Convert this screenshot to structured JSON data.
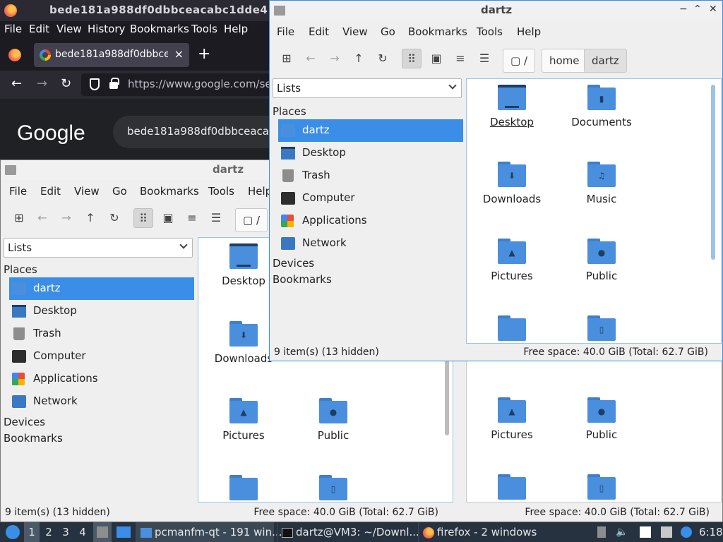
{
  "firefox": {
    "window_title": "bede181a988df0dbbceacabc1dde414",
    "menu": [
      "File",
      "Edit",
      "View",
      "History",
      "Bookmarks",
      "Tools",
      "Help"
    ],
    "tab_title": "bede181a988df0dbbceac",
    "tab_close": "×",
    "new_tab": "+",
    "url": "https://www.google.com/sea",
    "google_logo": "Google",
    "search_text": "bede181a988df0dbbceacab"
  },
  "fm_menu": [
    "File",
    "Edit",
    "View",
    "Go",
    "Bookmarks",
    "Tools",
    "Help"
  ],
  "fm_back": {
    "title": "dartz",
    "menu_visible": [
      "File",
      "Edit",
      "View",
      "Go",
      "Bookmarks",
      "Tools",
      "Help"
    ],
    "path_root": "/",
    "side_combo": "Lists",
    "places_label": "Places",
    "places": [
      "dartz",
      "Desktop",
      "Trash",
      "Computer",
      "Applications",
      "Network"
    ],
    "devices_label": "Devices",
    "bookmarks_label": "Bookmarks",
    "files": [
      "Desktop",
      "Downloads",
      "Pictures",
      "Public"
    ],
    "right_files": [
      "Pictures",
      "Public"
    ],
    "status_left": "9 item(s) (13 hidden)",
    "status_right": "Free space: 40.0 GiB (Total: 62.7 GiB)"
  },
  "fm_front": {
    "title": "dartz",
    "win_controls": [
      "−",
      "⌃",
      "✕"
    ],
    "path": [
      "/",
      "home",
      "dartz"
    ],
    "side_combo": "Lists",
    "places_label": "Places",
    "places": [
      "dartz",
      "Desktop",
      "Trash",
      "Computer",
      "Applications",
      "Network"
    ],
    "devices_label": "Devices",
    "bookmarks_label": "Bookmarks",
    "files": [
      "Desktop",
      "Documents",
      "Downloads",
      "Music",
      "Pictures",
      "Public"
    ],
    "status_left": "9 item(s) (13 hidden)",
    "status_right": "Free space: 40.0 GiB (Total: 62.7 GiB)"
  },
  "taskbar": {
    "workspaces": [
      "1",
      "2",
      "3",
      "4"
    ],
    "tasks": [
      "pcmanfm-qt - 191 win...",
      "dartz@VM3: ~/Downl...",
      "firefox - 2 windows"
    ],
    "clock": "6:18"
  }
}
